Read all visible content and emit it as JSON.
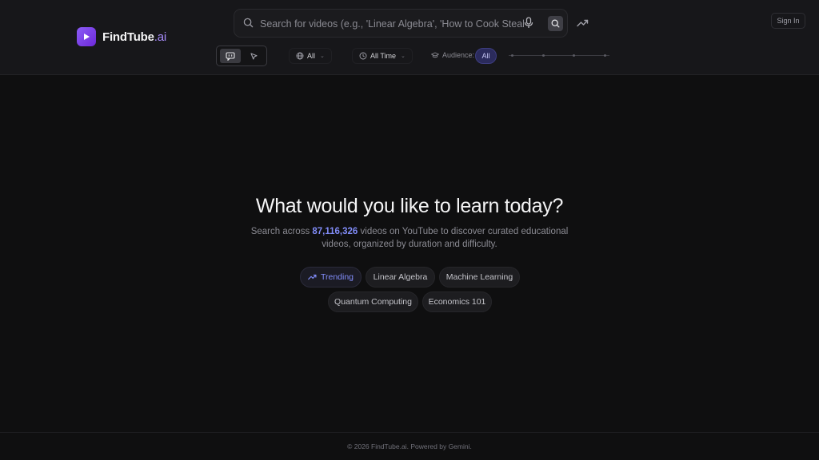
{
  "brand": {
    "name": "FindTube",
    "suffix": ".ai"
  },
  "search": {
    "placeholder": "Search for videos (e.g., 'Linear Algebra', 'How to Cook Steak')...",
    "value": ""
  },
  "header": {
    "signin_label": "Sign In"
  },
  "filters": {
    "language": {
      "value": "All",
      "icon": "globe-icon"
    },
    "time": {
      "value": "All Time",
      "icon": "clock-icon"
    },
    "audience": {
      "label": "Audience:",
      "value": "All",
      "icon": "graduation-cap-icon"
    }
  },
  "hero": {
    "title": "What would you like to learn today?",
    "sub_prefix": "Search across ",
    "count": "87,116,326",
    "sub_suffix": " videos on YouTube to discover curated educational videos, organized by duration and difficulty."
  },
  "suggestions": {
    "trending": "Trending",
    "items": [
      "Linear Algebra",
      "Machine Learning",
      "Quantum Computing",
      "Economics 101"
    ]
  },
  "footer": {
    "text": "© 2026 FindTube.ai. Powered by Gemini."
  },
  "colors": {
    "accent": "#818cf8",
    "brand": "#8b5cf6",
    "background": "#0f0f10"
  }
}
